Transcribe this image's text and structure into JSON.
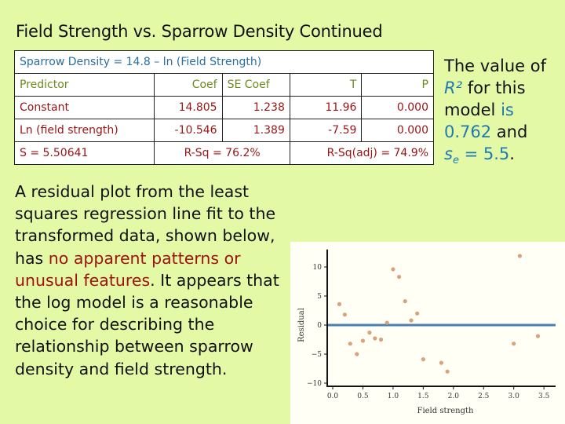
{
  "title": "Field Strength vs. Sparrow Density Continued",
  "regression_table": {
    "equation": "Sparrow Density = 14.8 – ln (Field Strength)",
    "headers": [
      "Predictor",
      "Coef",
      "SE Coef",
      "T",
      "P"
    ],
    "rows": [
      [
        "Constant",
        "14.805",
        "1.238",
        "11.96",
        "0.000"
      ],
      [
        "Ln (field strength)",
        "-10.546",
        "1.389",
        "-7.59",
        "0.000"
      ]
    ],
    "summary": {
      "s": "S = 5.50641",
      "rsq": "R-Sq = 76.2%",
      "rsq_adj": "R-Sq(adj) = 74.9%"
    }
  },
  "side_note": {
    "line1": "The value of",
    "r2_label": "R²",
    "line2_rest": " for this",
    "line3_a": "model ",
    "line3_b": "is",
    "value": "0.762",
    "line4_rest": " and",
    "se_label": "s",
    "se_sub": "e",
    "se_value": " = 5.5",
    "period": "."
  },
  "body_text": {
    "part1": "A residual plot from the least squares regression line fit to the transformed data, shown below, has ",
    "highlight": "no apparent patterns or unusual features",
    "part2": ". It appears that the log model is a reasonable choice for describing the relationship between sparrow density and field strength."
  },
  "colors": {
    "background": "#e4f9a6",
    "point": "#d9a27c",
    "zero_line": "#4a7fb0",
    "highlight": "#a01212"
  },
  "chart_data": {
    "type": "scatter",
    "title": "",
    "xlabel": "Field strength",
    "ylabel": "Residual",
    "xlim": [
      -0.1,
      3.6
    ],
    "ylim": [
      -10,
      13
    ],
    "xticks": [
      0.0,
      0.5,
      1.0,
      1.5,
      2.0,
      2.5,
      3.0,
      3.5
    ],
    "xtick_labels": [
      "0.0",
      "0.5",
      "1.0",
      "1.5",
      "2.0",
      "2.5",
      "3.0",
      "3.5"
    ],
    "yticks": [
      -10,
      -5,
      0,
      5,
      10
    ],
    "ytick_labels": [
      "−10",
      "−5",
      "0",
      "5",
      "10"
    ],
    "reference_line": 0,
    "grid": false,
    "legend": "none",
    "series": [
      {
        "name": "Residuals",
        "x": [
          0.11,
          0.2,
          0.29,
          0.4,
          0.5,
          0.61,
          0.7,
          0.8,
          0.9,
          1.0,
          1.1,
          1.2,
          1.3,
          1.4,
          1.5,
          1.8,
          1.9,
          3.0,
          3.1,
          3.4
        ],
        "y": [
          3.6,
          1.8,
          -3.2,
          -5.0,
          -2.7,
          -1.3,
          -2.3,
          -2.5,
          0.4,
          9.6,
          8.3,
          4.1,
          0.8,
          2.0,
          -5.9,
          -6.5,
          -8.0,
          -3.2,
          11.9,
          -1.9
        ]
      }
    ]
  }
}
